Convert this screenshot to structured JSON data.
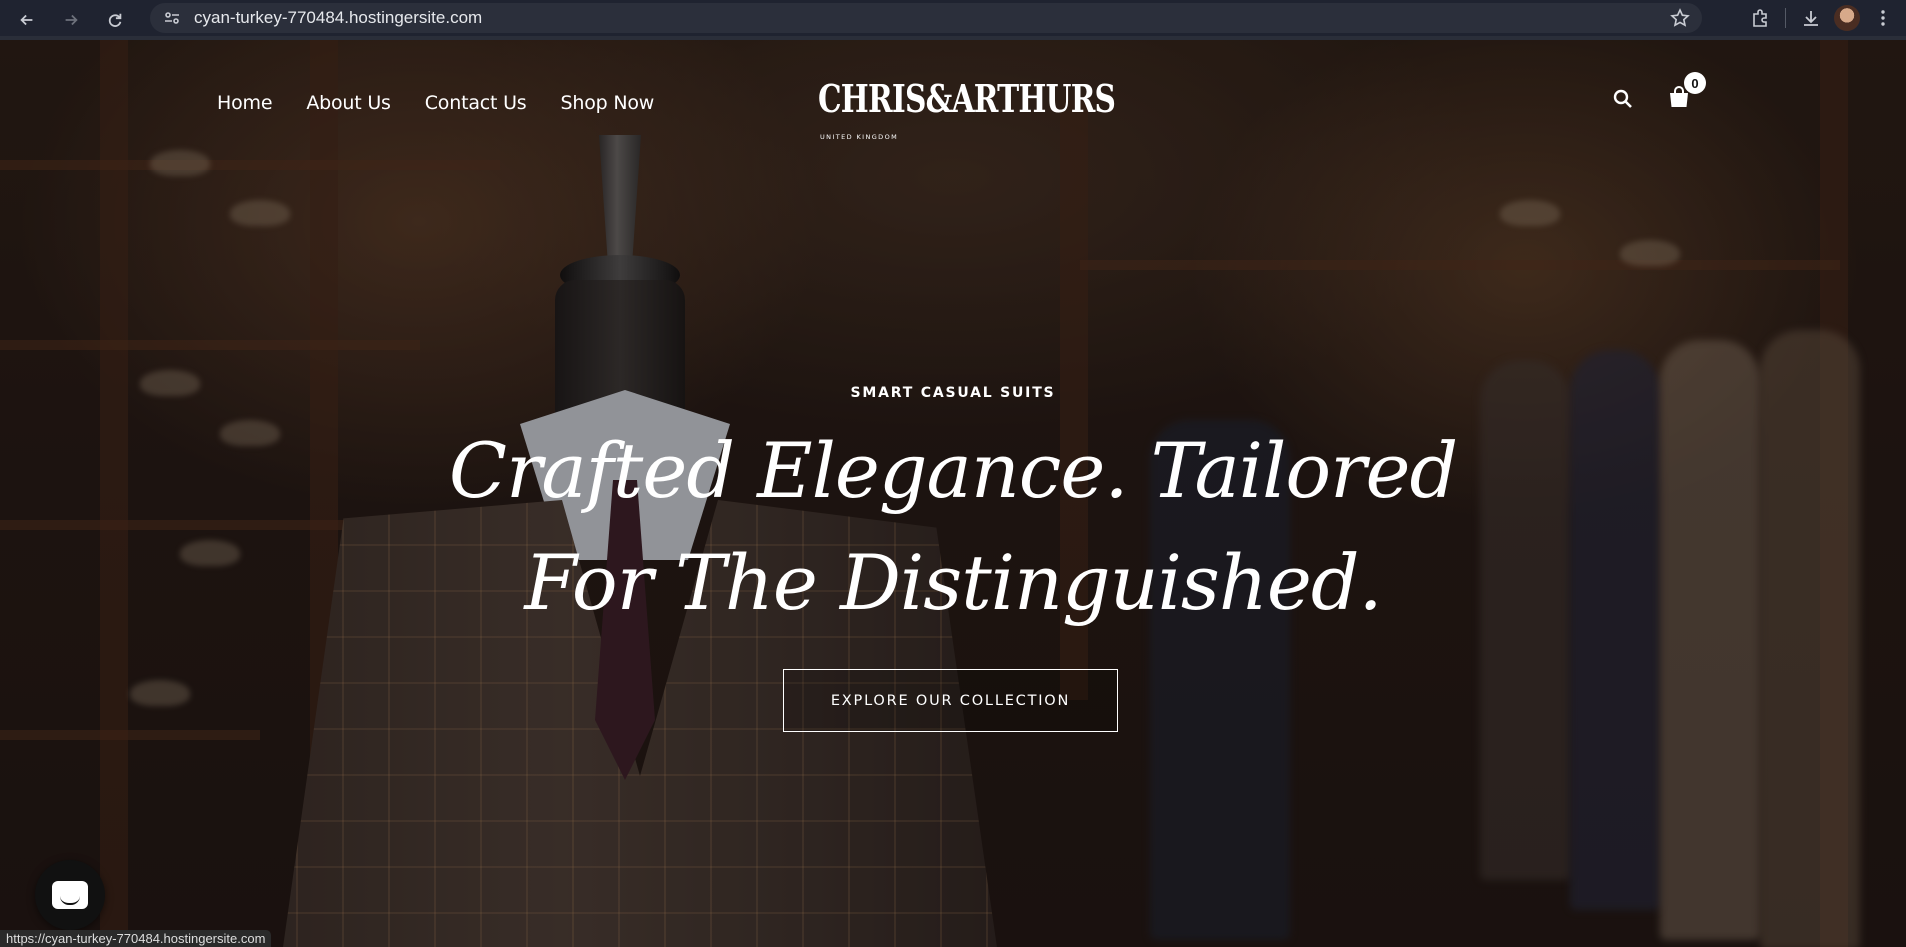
{
  "browser": {
    "url": "cyan-turkey-770484.hostingersite.com",
    "status_url": "https://cyan-turkey-770484.hostingersite.com"
  },
  "site": {
    "nav": [
      {
        "label": "Home"
      },
      {
        "label": "About Us"
      },
      {
        "label": "Contact Us"
      },
      {
        "label": "Shop Now"
      }
    ],
    "logo": {
      "brand": "CHRIS&ARTHURS",
      "sub": "UNITED KINGDOM"
    },
    "cart_count": "0"
  },
  "hero": {
    "eyebrow": "SMART CASUAL SUITS",
    "headline_line1": "Crafted Elegance. Tailored",
    "headline_line2": "For The Distinguished.",
    "cta": "EXPLORE OUR COLLECTION"
  },
  "icons": {
    "back": "back-arrow-icon",
    "forward": "forward-arrow-icon",
    "reload": "reload-icon",
    "site_info": "site-info-icon",
    "bookmark": "star-icon",
    "extensions": "puzzle-icon",
    "downloads": "download-icon",
    "menu": "kebab-menu-icon",
    "search": "search-icon",
    "cart": "shopping-bag-icon",
    "chat": "chat-icon"
  }
}
